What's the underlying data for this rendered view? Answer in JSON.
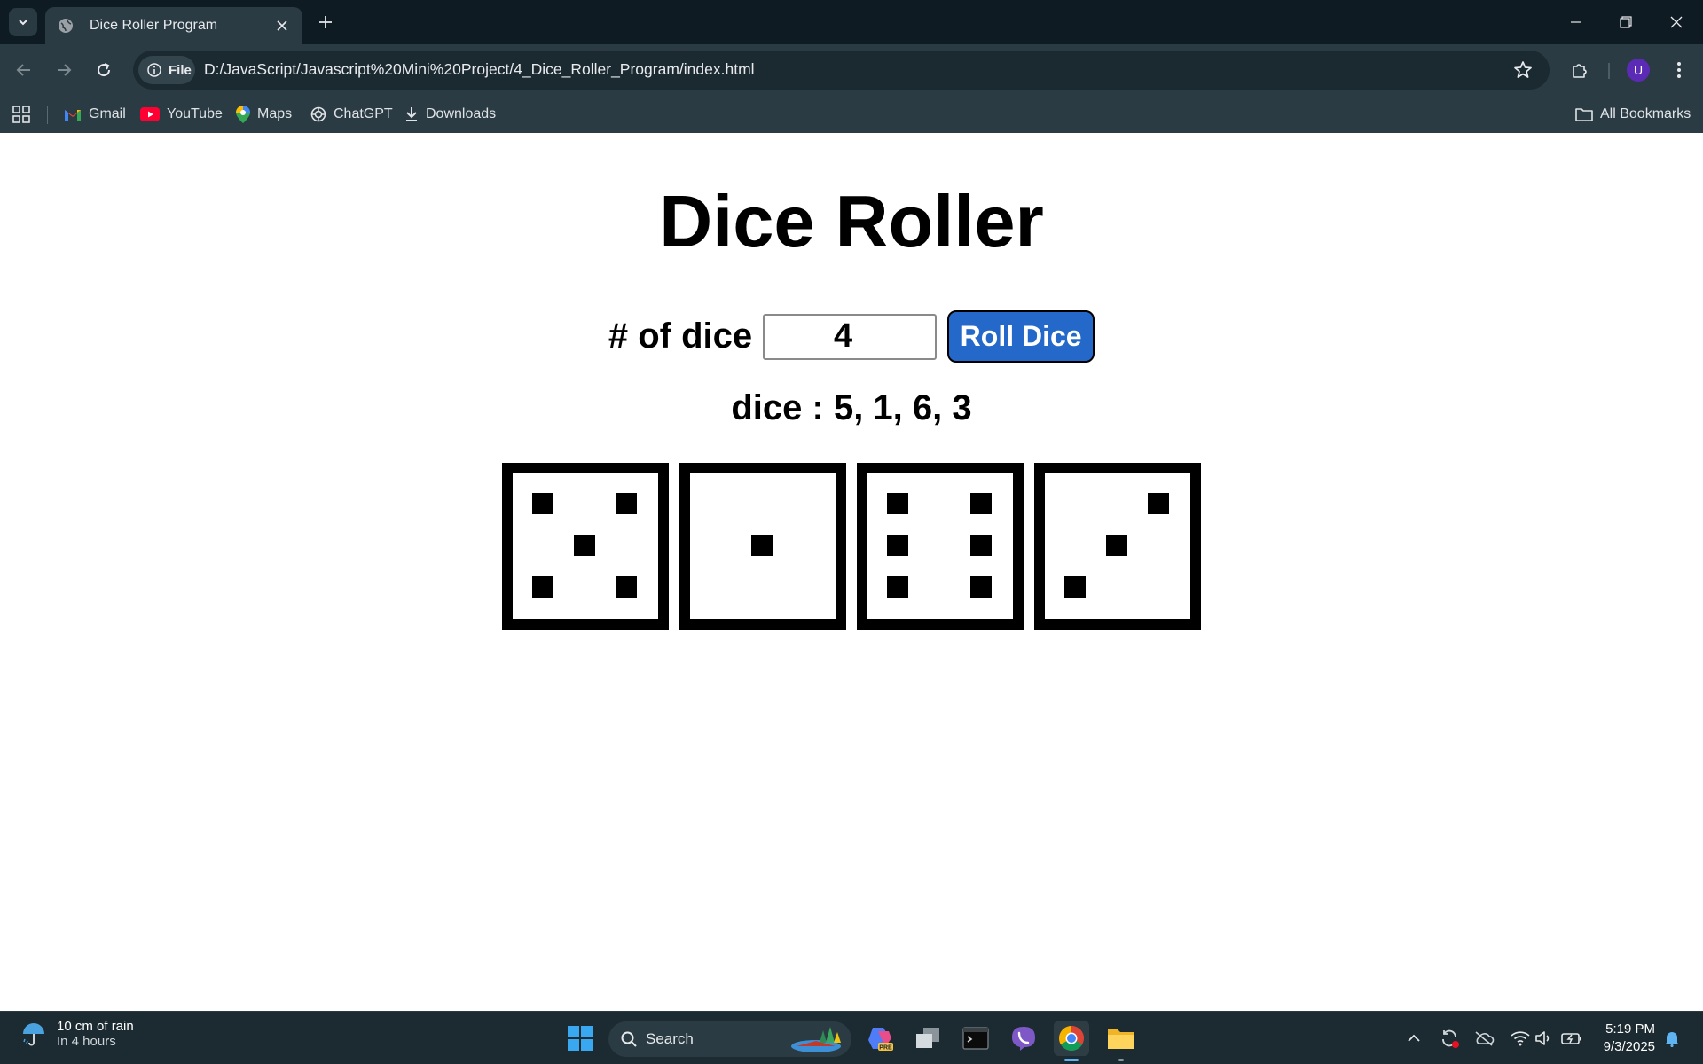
{
  "browser": {
    "tab_title": "Dice Roller Program",
    "url_chip": "File",
    "url": "D:/JavaScript/Javascript%20Mini%20Project/4_Dice_Roller_Program/index.html",
    "avatar_letter": "U",
    "bookmarks": [
      {
        "label": "Gmail",
        "icon": "gmail-icon"
      },
      {
        "label": "YouTube",
        "icon": "youtube-icon"
      },
      {
        "label": "Maps",
        "icon": "maps-icon"
      },
      {
        "label": "ChatGPT",
        "icon": "chatgpt-icon"
      },
      {
        "label": "Downloads",
        "icon": "download-icon"
      }
    ],
    "all_bookmarks": "All Bookmarks"
  },
  "page": {
    "title": "Dice Roller",
    "dice_label": "# of dice",
    "dice_count": "4",
    "roll_button": "Roll Dice",
    "result_text": "dice : 5, 1, 6, 3",
    "dice_values": [
      5,
      1,
      6,
      3
    ]
  },
  "taskbar": {
    "weather_line1": "10 cm of rain",
    "weather_line2": "In 4 hours",
    "search_label": "Search",
    "time": "5:19 PM",
    "date": "9/3/2025"
  },
  "colors": {
    "roll_button": "#2469c9",
    "chrome_bg": "#2b3b43",
    "tabbar_bg": "#0f1b22",
    "taskbar_bg": "#1c2a31"
  }
}
